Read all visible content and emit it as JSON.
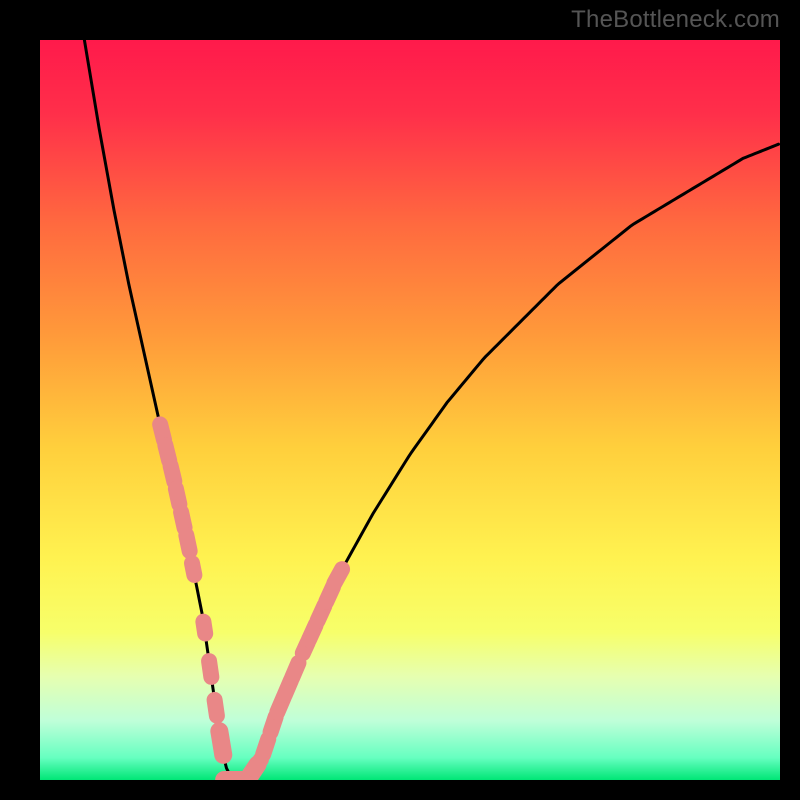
{
  "watermark": "TheBottleneck.com",
  "colors": {
    "gradient_stops": [
      {
        "offset": 0.0,
        "color": "#ff1a4b"
      },
      {
        "offset": 0.1,
        "color": "#ff2f4a"
      },
      {
        "offset": 0.25,
        "color": "#ff6a3f"
      },
      {
        "offset": 0.4,
        "color": "#ff9a3a"
      },
      {
        "offset": 0.55,
        "color": "#ffcf3c"
      },
      {
        "offset": 0.7,
        "color": "#fff250"
      },
      {
        "offset": 0.8,
        "color": "#f7ff6a"
      },
      {
        "offset": 0.86,
        "color": "#e6ffb0"
      },
      {
        "offset": 0.92,
        "color": "#bfffd9"
      },
      {
        "offset": 0.97,
        "color": "#66ffc0"
      },
      {
        "offset": 1.0,
        "color": "#00e676"
      }
    ],
    "curve": "#000000",
    "beads": "#e98787",
    "frame": "#000000"
  },
  "chart_data": {
    "type": "line",
    "title": "",
    "xlabel": "",
    "ylabel": "",
    "xlim": [
      0,
      100
    ],
    "ylim": [
      0,
      100
    ],
    "grid": false,
    "legend": false,
    "series": [
      {
        "name": "bottleneck-curve",
        "x": [
          6,
          8,
          10,
          12,
          14,
          16,
          18,
          20,
          21,
          22,
          23,
          24,
          25,
          26,
          28,
          30,
          32,
          35,
          40,
          45,
          50,
          55,
          60,
          65,
          70,
          75,
          80,
          85,
          90,
          95,
          100
        ],
        "y": [
          100,
          88,
          77,
          67,
          58,
          49,
          41,
          32,
          27,
          22,
          15,
          8,
          2,
          0,
          0,
          3,
          9,
          16,
          27,
          36,
          44,
          51,
          57,
          62,
          67,
          71,
          75,
          78,
          81,
          84,
          86
        ]
      }
    ],
    "bead_clusters": [
      {
        "side": "left",
        "x_range": [
          16.5,
          20.0
        ],
        "count": 6
      },
      {
        "side": "left",
        "x_range": [
          20.4,
          21.0
        ],
        "count": 1
      },
      {
        "side": "left",
        "x_range": [
          21.8,
          22.6
        ],
        "count": 1
      },
      {
        "side": "left",
        "x_range": [
          23.0,
          24.5
        ],
        "count": 3
      },
      {
        "side": "bottom",
        "x_range": [
          24.5,
          28.5
        ],
        "count": 3
      },
      {
        "side": "right",
        "x_range": [
          28.8,
          30.0
        ],
        "count": 1
      },
      {
        "side": "right",
        "x_range": [
          30.5,
          34.5
        ],
        "count": 5
      },
      {
        "side": "right",
        "x_range": [
          35.5,
          36.2
        ],
        "count": 1
      },
      {
        "side": "right",
        "x_range": [
          36.8,
          40.3
        ],
        "count": 4
      }
    ]
  }
}
